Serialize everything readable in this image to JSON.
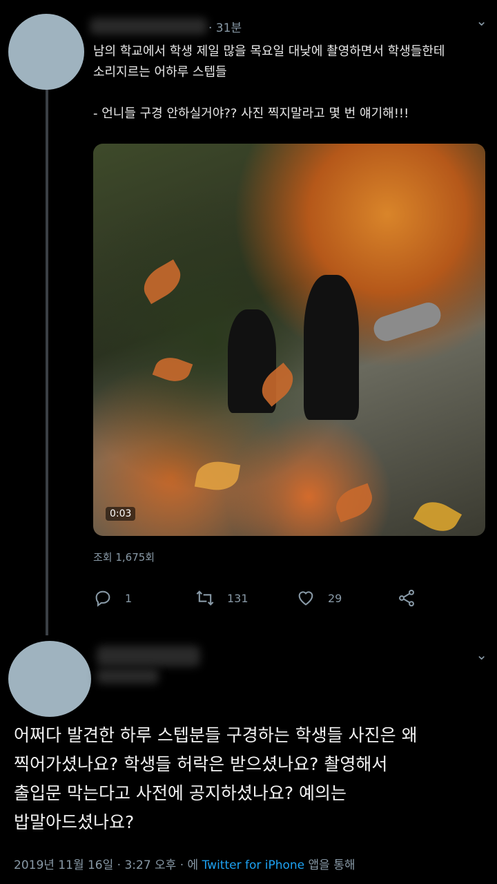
{
  "tweet": {
    "time": "· 31분",
    "lines": [
      "남의 학교에서 학생 제일 많을 목요일 대낮에 촬영하면서 학생들한테",
      "소리지르는 어하루 스텝들",
      "",
      "- 언니들 구경 안하실거야?? 사진 찍지말라고 몇 번 얘기해!!!"
    ],
    "video_time": "0:03",
    "views": "조회 1,675회",
    "reply_count": "1",
    "retweet_count": "131",
    "like_count": "29"
  },
  "reply": {
    "lines": [
      "어쩌다 발견한 하루 스텝분들 구경하는 학생들 사진은 왜",
      "찍어가셨나요? 학생들 허락은 받으셨나요? 촬영해서",
      "출입문 막는다고 사전에 공지하셨나요? 예의는",
      "밥말아드셨나요?"
    ],
    "date": "2019년 11월 16일 · 3:27 오후 · 에 ",
    "source": "Twitter for iPhone",
    "suffix": " 앱을 통해"
  },
  "colors": {
    "background": "#000000",
    "muted": "#8899a6",
    "link": "#1da1f2"
  },
  "icons": [
    "reply-icon",
    "retweet-icon",
    "like-icon",
    "share-icon",
    "chevron-down-icon"
  ]
}
